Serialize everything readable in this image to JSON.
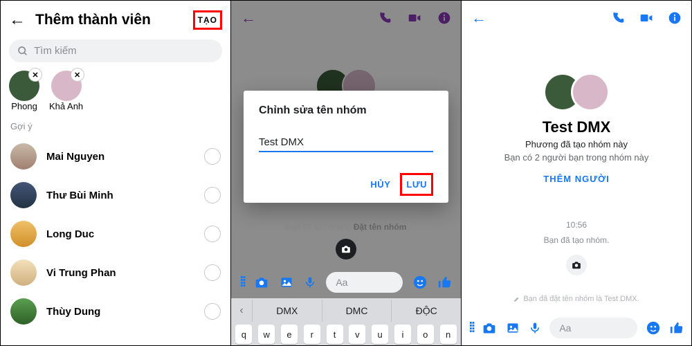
{
  "panel1": {
    "title": "Thêm thành viên",
    "create_label": "TẠO",
    "search_placeholder": "Tìm kiếm",
    "selected": [
      {
        "name": "Phong"
      },
      {
        "name": "Khả Anh"
      }
    ],
    "suggestion_label": "Gợi ý",
    "suggestions": [
      {
        "name": "Mai Nguyen"
      },
      {
        "name": "Thư Bùi Minh"
      },
      {
        "name": "Long Duc"
      },
      {
        "name": "Vi Trung Phan"
      },
      {
        "name": "Thùy Dung"
      }
    ]
  },
  "panel2": {
    "dialog_title": "Chỉnh sửa tên nhóm",
    "input_value": "Test DMX",
    "cancel_label": "HỦY",
    "save_label": "LƯU",
    "created_line_a": "Bạn đã tạo nhóm.",
    "created_line_b": "Đặt tên nhóm",
    "composer_placeholder": "Aa",
    "kb_suggestions": [
      "DMX",
      "DMC",
      "ĐỘC"
    ],
    "kb_row": [
      "q",
      "w",
      "e",
      "r",
      "t",
      "v",
      "u",
      "i",
      "o",
      "n"
    ]
  },
  "panel3": {
    "group_name": "Test DMX",
    "creator_line": "Phương đã tạo nhóm này",
    "friends_line": "Bạn có 2 người bạn trong nhóm này",
    "add_people_label": "THÊM NGƯỜI",
    "time": "10:56",
    "created_line": "Bạn đã tạo nhóm.",
    "named_line": "Bạn đã đặt tên nhóm là Test DMX.",
    "composer_placeholder": "Aa"
  }
}
